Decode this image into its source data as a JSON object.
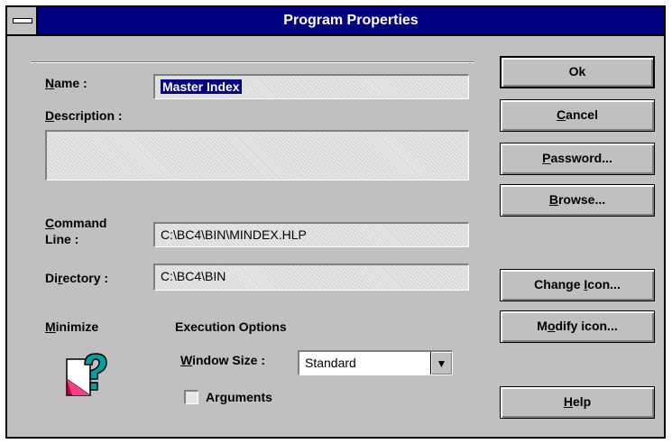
{
  "window": {
    "title": "Program Properties"
  },
  "form": {
    "name_label": "Name :",
    "name_value": "Master Index",
    "description_label": "Description :",
    "description_value": "",
    "command_line_label_1": "Command",
    "command_line_label_2": "Line :",
    "command_line_value": "C:\\BC4\\BIN\\MINDEX.HLP",
    "directory_label": "Directory :",
    "directory_value": "C:\\BC4\\BIN",
    "minimize_label": "Minimize",
    "execution_options_label": "Execution Options",
    "window_size_label": "Window Size :",
    "window_size_value": "Standard",
    "arguments_label": "Arguments",
    "arguments_checked": false
  },
  "buttons": {
    "ok": "Ok",
    "cancel": "Cancel",
    "password": "Password...",
    "browse": "Browse...",
    "change_icon": "Change Icon...",
    "modify_icon": "Modify icon...",
    "help": "Help"
  },
  "icons": {
    "system_menu": "system-menu-icon",
    "program": "help-file-icon",
    "dropdown": "dropdown-arrow-icon"
  },
  "colors": {
    "title_bar": "#000080",
    "dialog_face": "#c0c0c0",
    "selection": "#000080"
  }
}
